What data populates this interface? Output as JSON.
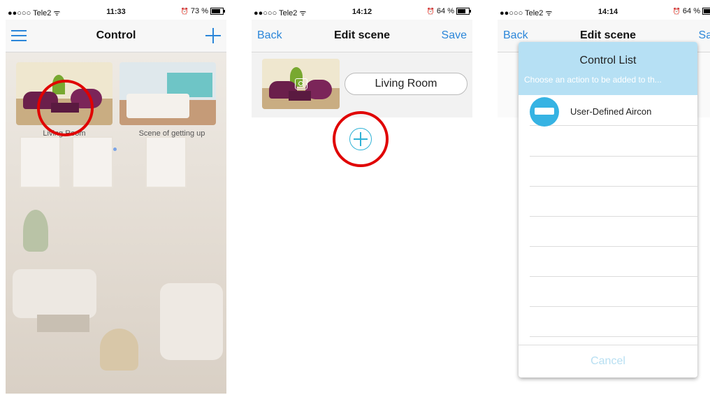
{
  "screens": [
    {
      "status": {
        "carrier": "●●○○○ Tele2 ᯤ",
        "time": "11:33",
        "battery": "73 %",
        "battery_level": 0.73
      },
      "nav": {
        "title": "Control"
      },
      "scenes": [
        {
          "label": "Living Room"
        },
        {
          "label": "Scene of getting up"
        }
      ]
    },
    {
      "status": {
        "carrier": "●●○○○ Tele2 ᯤ",
        "time": "14:12",
        "battery": "64 %",
        "battery_level": 0.64
      },
      "nav": {
        "back": "Back",
        "title": "Edit scene",
        "save": "Save"
      },
      "scene_name": "Living Room"
    },
    {
      "status": {
        "carrier": "●●○○○ Tele2 ᯤ",
        "time": "14:14",
        "battery": "64 %",
        "battery_level": 0.64
      },
      "nav": {
        "back": "Back",
        "title": "Edit scene",
        "save": "Save"
      },
      "modal": {
        "title": "Control List",
        "subtitle": "Choose an action to be added to th...",
        "items": [
          "User-Defined Aircon"
        ],
        "cancel": "Cancel"
      }
    }
  ],
  "colors": {
    "accent": "#2b86d9",
    "highlight_circle": "#e00000",
    "modal_header": "#b6e0f4",
    "add_button": "#2fb2d6"
  },
  "icons": [
    "menu-icon",
    "plus-icon",
    "camera-icon",
    "add-circle-icon",
    "aircon-icon",
    "alarm-icon",
    "battery-icon"
  ]
}
